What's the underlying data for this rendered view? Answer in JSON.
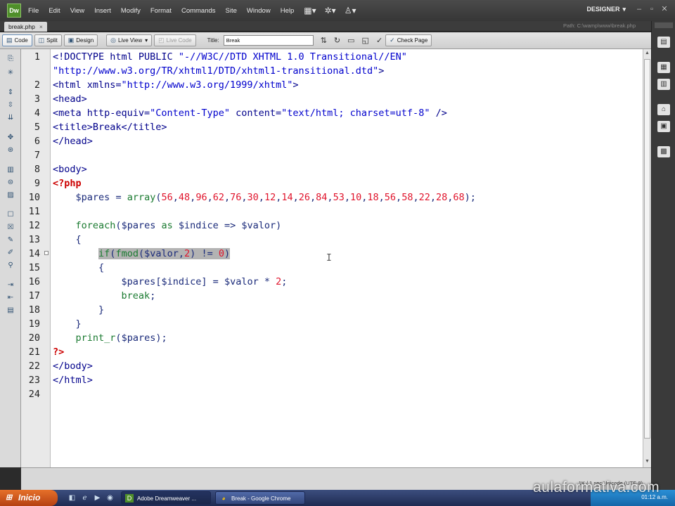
{
  "app": {
    "logo": "Dw",
    "menu": [
      "File",
      "Edit",
      "View",
      "Insert",
      "Modify",
      "Format",
      "Commands",
      "Site",
      "Window",
      "Help"
    ],
    "menu_icons": [
      "layout-icon",
      "gear-icon",
      "user-icon"
    ],
    "workspace": "DESIGNER"
  },
  "document": {
    "tab_label": "break.php",
    "path": "Path: C:\\wamp\\www\\break.php"
  },
  "toolbar": {
    "code": "Code",
    "split": "Split",
    "design": "Design",
    "live_view": "Live View",
    "live_code": "Live Code",
    "title_label": "Title:",
    "title_value": "Break",
    "check_page": "Check Page"
  },
  "code": {
    "lines": [
      {
        "num": "1",
        "text": "<!DOCTYPE html PUBLIC \"-//W3C//DTD XHTML 1.0 Transitional//EN\""
      },
      {
        "num": "",
        "text": "\"http://www.w3.org/TR/xhtml1/DTD/xhtml1-transitional.dtd\">"
      },
      {
        "num": "2",
        "text": "<html xmlns=\"http://www.w3.org/1999/xhtml\">"
      },
      {
        "num": "3",
        "text": "<head>"
      },
      {
        "num": "4",
        "text": "<meta http-equiv=\"Content-Type\" content=\"text/html; charset=utf-8\" />"
      },
      {
        "num": "5",
        "text": "<title>Break</title>"
      },
      {
        "num": "6",
        "text": "</head>"
      },
      {
        "num": "7",
        "text": ""
      },
      {
        "num": "8",
        "text": "<body>"
      },
      {
        "num": "9",
        "text": "<?php"
      },
      {
        "num": "10",
        "text": "    $pares = array(56,48,96,62,76,30,12,14,26,84,53,10,18,56,58,22,28,68);"
      },
      {
        "num": "11",
        "text": ""
      },
      {
        "num": "12",
        "text": "    foreach($pares as $indice => $valor)"
      },
      {
        "num": "13",
        "text": "    {"
      },
      {
        "num": "14",
        "text": "        if(fmod($valor,2) != 0)"
      },
      {
        "num": "15",
        "text": "        {"
      },
      {
        "num": "16",
        "text": "            $pares[$indice] = $valor * 2;"
      },
      {
        "num": "17",
        "text": "            break;"
      },
      {
        "num": "18",
        "text": "        }"
      },
      {
        "num": "19",
        "text": "    }"
      },
      {
        "num": "20",
        "text": "    print_r($pares);"
      },
      {
        "num": "21",
        "text": "?>"
      },
      {
        "num": "22",
        "text": "</body>"
      },
      {
        "num": "23",
        "text": "</html>"
      },
      {
        "num": "24",
        "text": ""
      }
    ]
  },
  "status": {
    "text": "1K / 1 sec  Unicode (UTF-8)"
  },
  "taskbar": {
    "start": "Inicio",
    "tasks": [
      {
        "label": "Adobe Dreamweaver ...",
        "active": true
      },
      {
        "label": "Break - Google Chrome",
        "active": false
      }
    ],
    "clock": "01:12 a.m."
  },
  "watermark": "aulaformativa.com",
  "colors": {
    "tag": "#00008b",
    "string": "#0000cd",
    "php_delimiter": "#cc0000",
    "keyword": "#1a7a30",
    "number": "#e0142c",
    "highlight": "#b3b3b3"
  }
}
